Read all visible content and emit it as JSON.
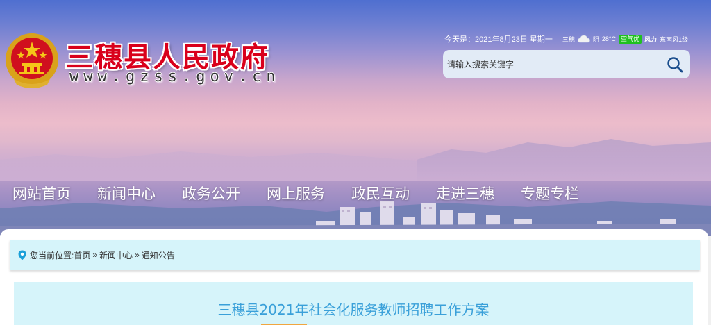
{
  "header": {
    "site_title": "三穗县人民政府",
    "site_domain": "www.gzss.gov.cn",
    "emblem_icon": "national-emblem-icon"
  },
  "info_bar": {
    "date_text": "今天是：2021年8月23日 星期一",
    "city": "三穗",
    "weather_icon": "cloud-icon",
    "weather": "阴",
    "temperature": "28°C",
    "air_quality": "空气优",
    "wind_label": "风力",
    "wind_value": "东南风1级"
  },
  "search": {
    "placeholder": "请输入搜索关键字",
    "icon": "search-icon"
  },
  "nav": {
    "items": [
      "网站首页",
      "新闻中心",
      "政务公开",
      "网上服务",
      "政民互动",
      "走进三穗",
      "专题专栏"
    ]
  },
  "breadcrumb": {
    "prefix": "您当前位置:",
    "items": [
      "首页",
      "新闻中心",
      "通知公告"
    ],
    "separator": "»",
    "icon": "location-pin-icon"
  },
  "article": {
    "title": "三穗县2021年社会化服务教师招聘工作方案"
  },
  "colors": {
    "title_red": "#d9001b",
    "aq_green": "#1fc01f",
    "panel_bg": "#d6f4fa",
    "article_title": "#3aa0d9",
    "accent_orange": "#f0a640"
  }
}
